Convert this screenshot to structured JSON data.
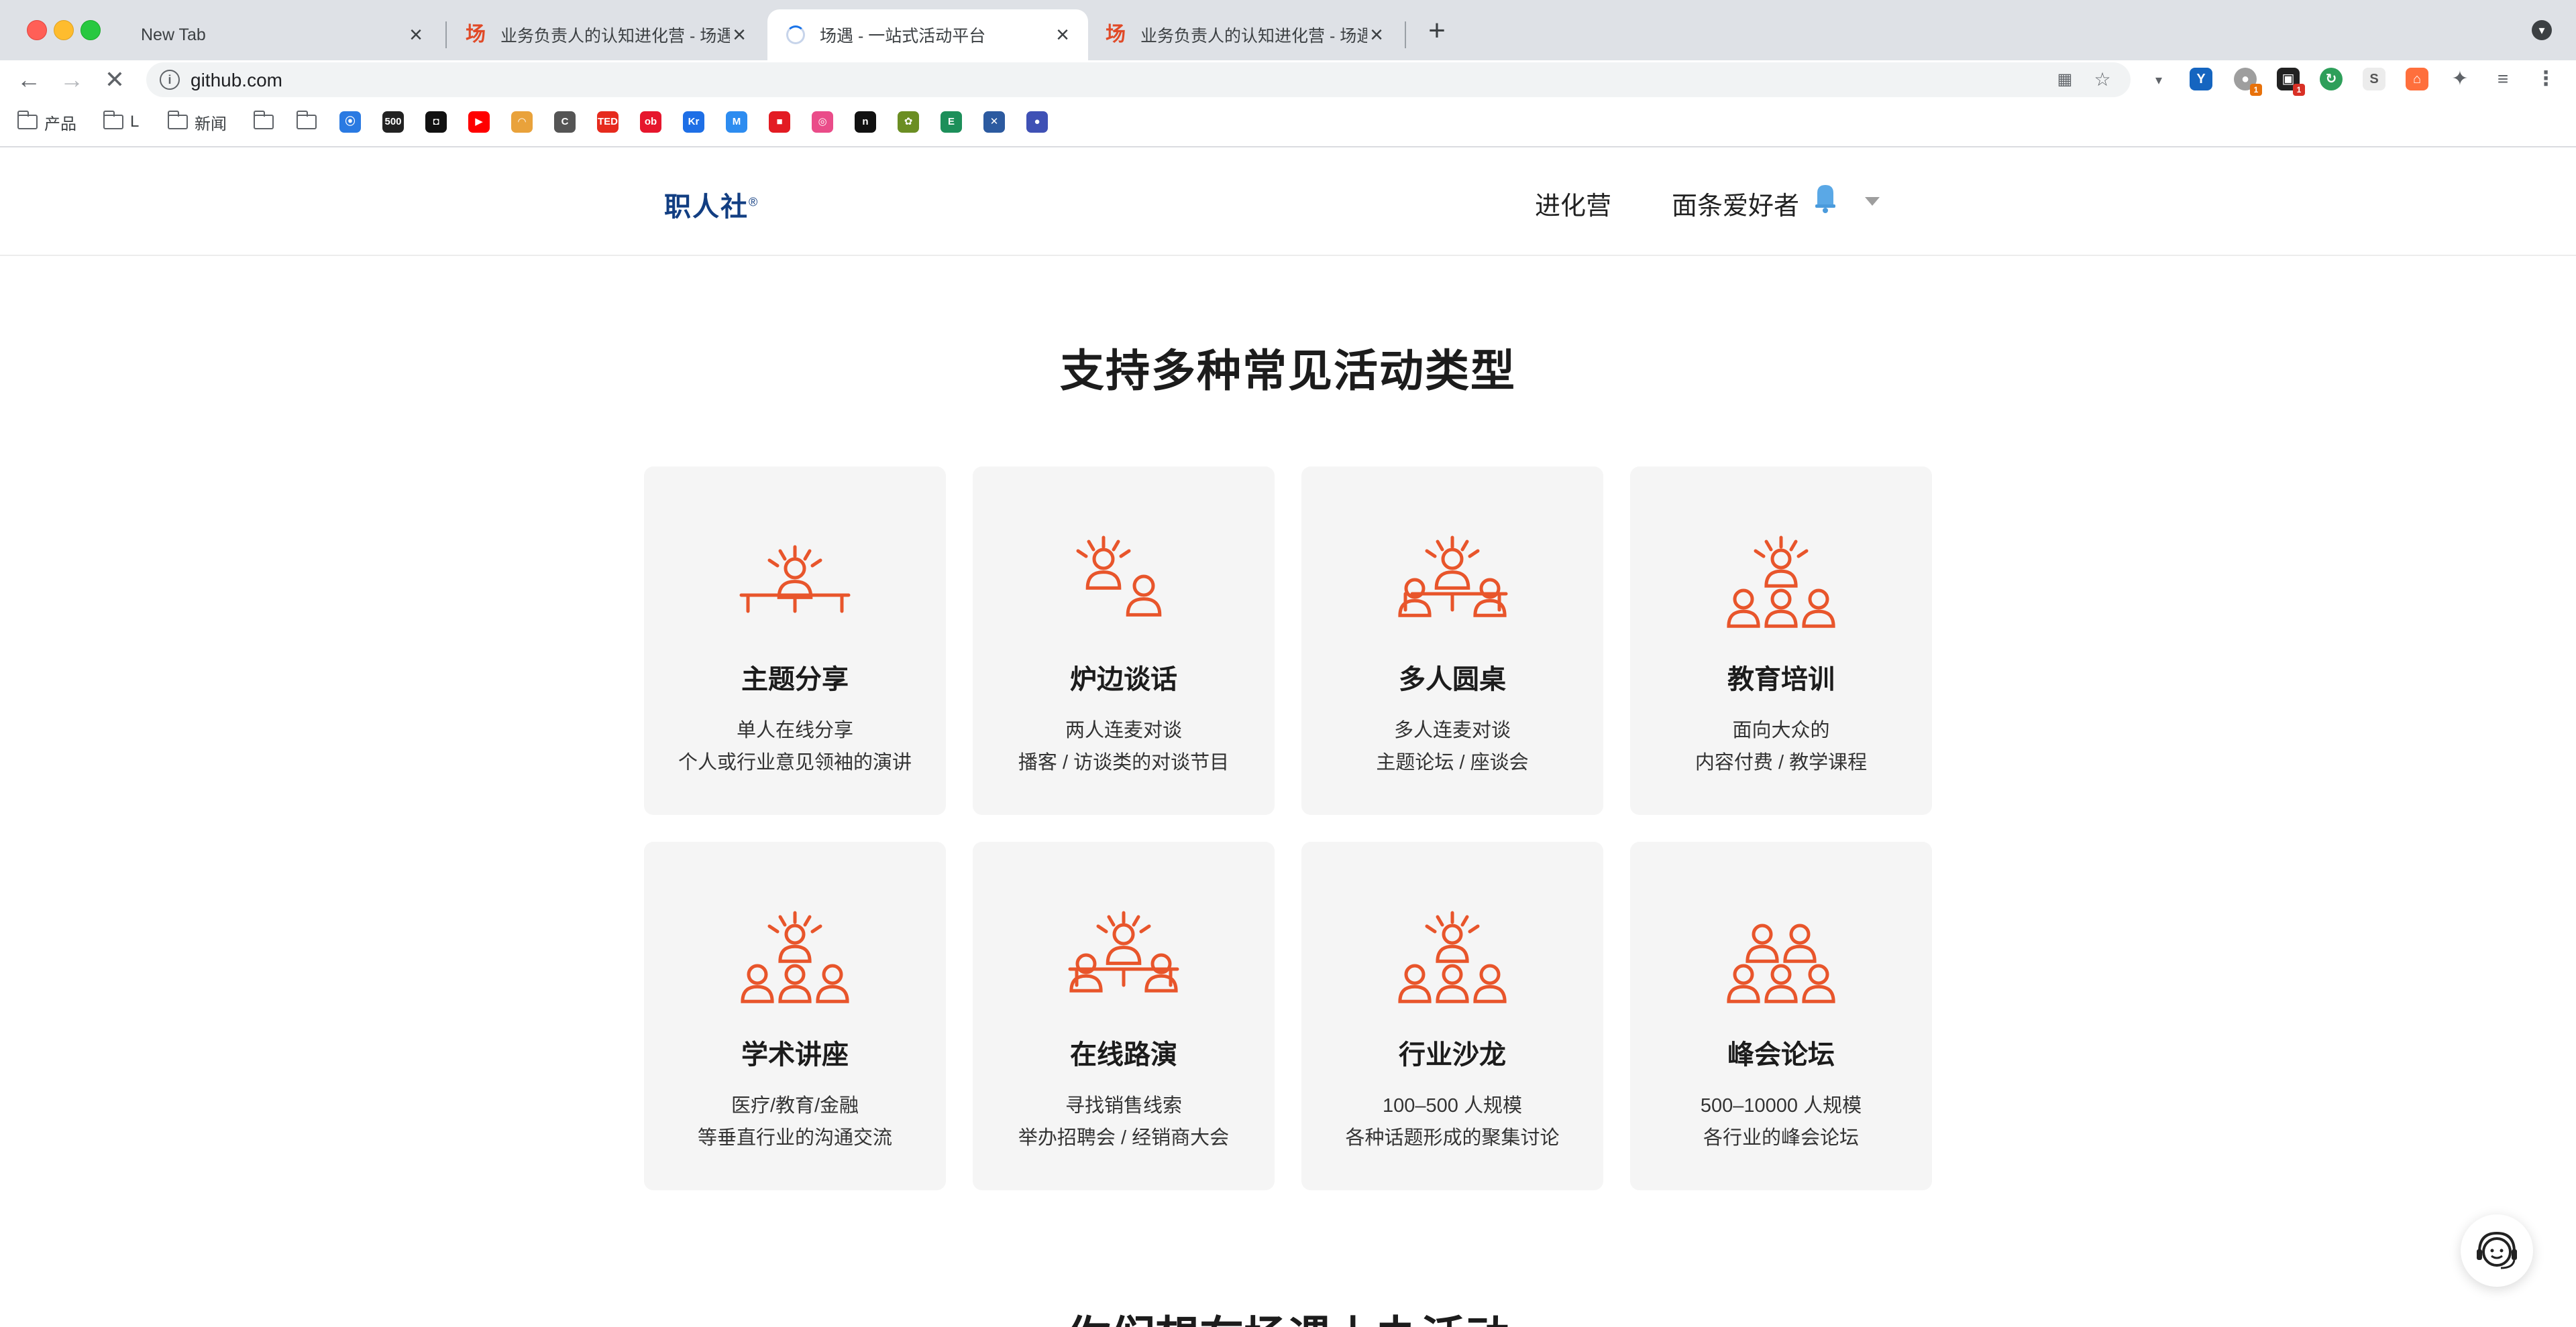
{
  "browser": {
    "tabs": [
      {
        "title": "New Tab"
      },
      {
        "title": "业务负责人的认知进化营 - 场遇"
      },
      {
        "title": "场遇 - 一站式活动平台"
      },
      {
        "title": "业务负责人的认知进化营 - 场遇"
      }
    ],
    "favicon_text": "场",
    "address": "github.com",
    "bookmarks": [
      {
        "label": "产品"
      },
      {
        "label": "L"
      },
      {
        "label": "新闻"
      }
    ],
    "bookmark_icons": [
      {
        "name": "bm-bank-icon",
        "text": "⦿",
        "color": "#2a7ae2"
      },
      {
        "name": "bm-500px-icon",
        "text": "500",
        "color": "#222222"
      },
      {
        "name": "bm-oculus-icon",
        "text": "◘",
        "color": "#111111"
      },
      {
        "name": "bm-youtube-icon",
        "text": "▶",
        "color": "#ff0000"
      },
      {
        "name": "bm-rainbow-icon",
        "text": "◠",
        "color": "#e9a23b"
      },
      {
        "name": "bm-csdn-icon",
        "text": "C",
        "color": "#555555"
      },
      {
        "name": "bm-ted-icon",
        "text": "TED",
        "color": "#e62b1e"
      },
      {
        "name": "bm-weibo-icon",
        "text": "ob",
        "color": "#e6162d"
      },
      {
        "name": "bm-36kr-icon",
        "text": "Kr",
        "color": "#1e6fe6"
      },
      {
        "name": "bm-huaban-icon",
        "text": "M",
        "color": "#2d8cf0"
      },
      {
        "name": "bm-red-book-icon",
        "text": "■",
        "color": "#e31c23"
      },
      {
        "name": "bm-dribbble-icon",
        "text": "◎",
        "color": "#ea4c89"
      },
      {
        "name": "bm-notion-icon",
        "text": "n",
        "color": "#111111"
      },
      {
        "name": "bm-leaf-icon",
        "text": "✿",
        "color": "#6b8e23"
      },
      {
        "name": "bm-excel-icon",
        "text": "E",
        "color": "#1d8f5a"
      },
      {
        "name": "bm-x-icon",
        "text": "✕",
        "color": "#2c5aa0"
      },
      {
        "name": "bm-circle-icon",
        "text": "●",
        "color": "#3f51b5"
      }
    ]
  },
  "site": {
    "logo": "职人社",
    "logo_mark": "®",
    "nav_camp": "进化营",
    "nav_user": "面条爱好者"
  },
  "section": {
    "title": "支持多种常见活动类型"
  },
  "activity_types": [
    {
      "title": "主题分享",
      "line1": "单人在线分享",
      "line2": "个人或行业意见领袖的演讲"
    },
    {
      "title": "炉边谈话",
      "line1": "两人连麦对谈",
      "line2": "播客 / 访谈类的对谈节目"
    },
    {
      "title": "多人圆桌",
      "line1": "多人连麦对谈",
      "line2": "主题论坛 / 座谈会"
    },
    {
      "title": "教育培训",
      "line1": "面向大众的",
      "line2": "内容付费 / 教学课程"
    },
    {
      "title": "学术讲座",
      "line1": "医疗/教育/金融",
      "line2": "等垂直行业的沟通交流"
    },
    {
      "title": "在线路演",
      "line1": "寻找销售线索",
      "line2": "举办招聘会 / 经销商大会"
    },
    {
      "title": "行业沙龙",
      "line1": "100–500 人规模",
      "line2": "各种话题形成的聚集讨论"
    },
    {
      "title": "峰会论坛",
      "line1": "500–10000 人规模",
      "line2": "各行业的峰会论坛"
    }
  ],
  "next_section": {
    "title": "你们想在场遇上办活动"
  },
  "colors": {
    "accent": "#e8552b",
    "logo": "#123e82",
    "card_bg": "#f5f5f5"
  }
}
